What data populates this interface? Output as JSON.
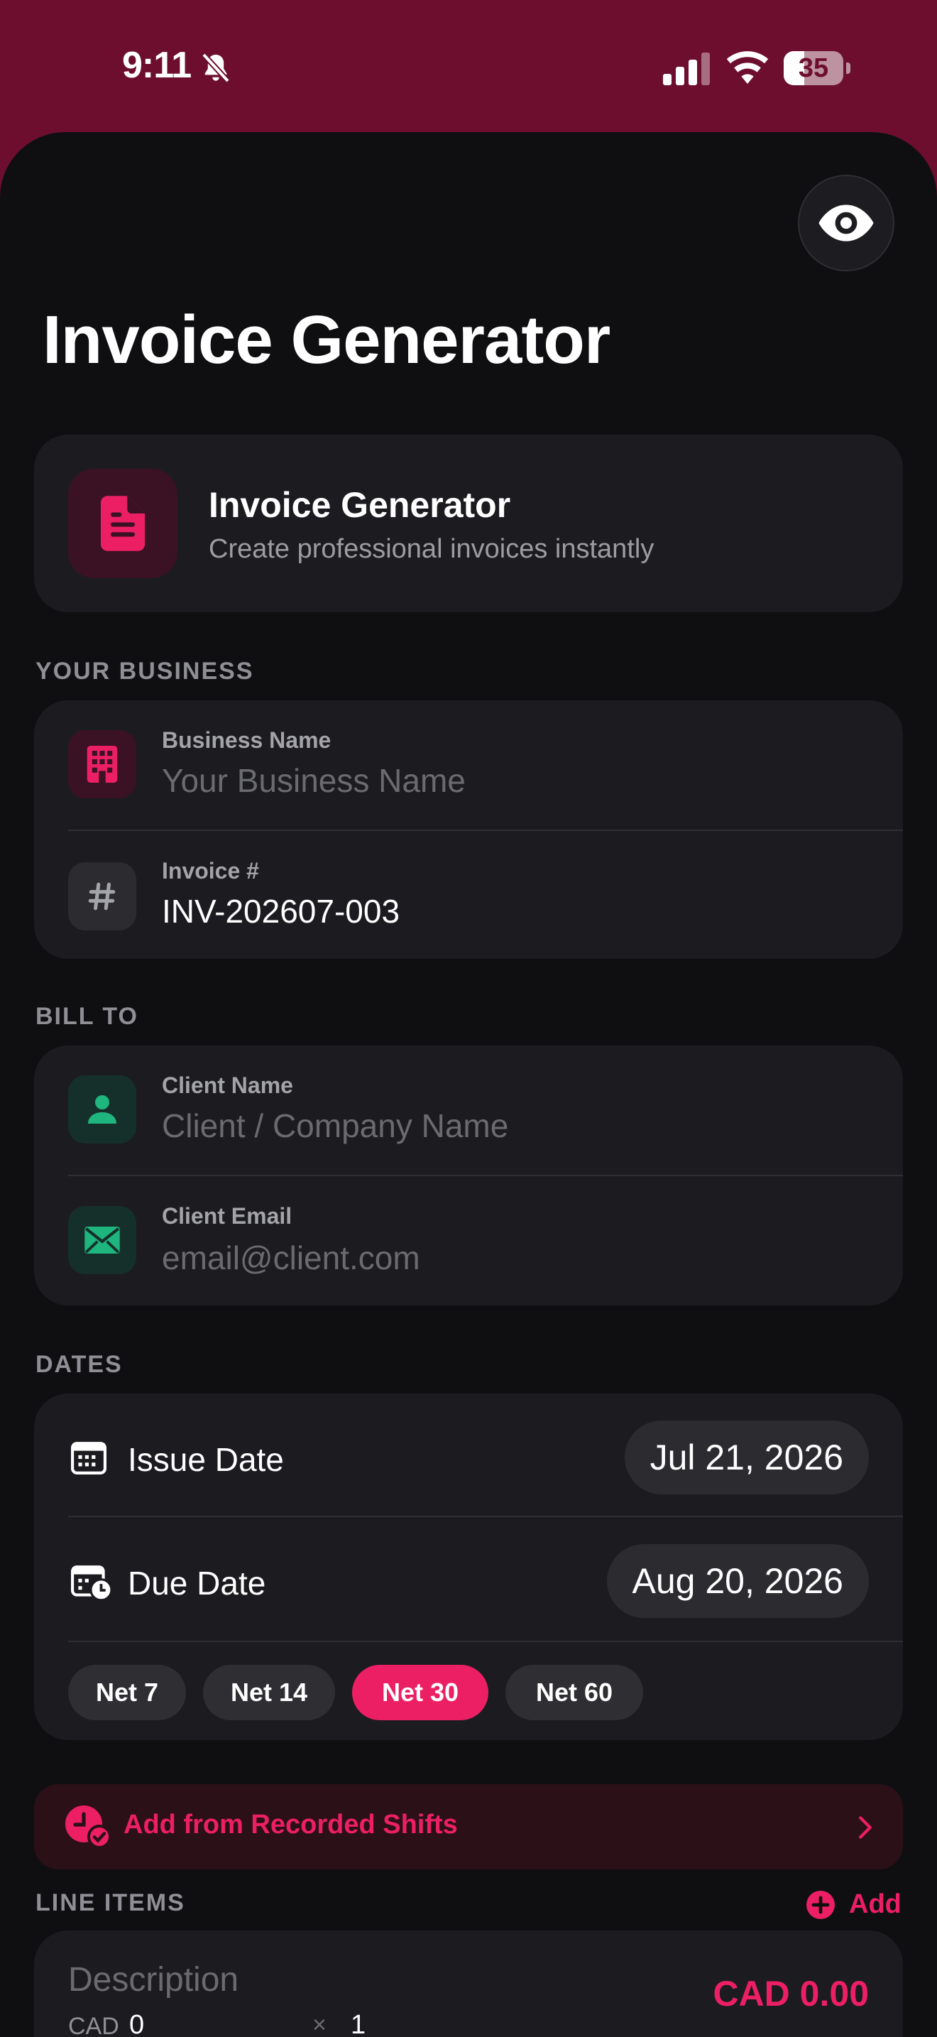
{
  "status_bar": {
    "time": "9:11",
    "battery": "35",
    "battery_level": 0.35
  },
  "page": {
    "title": "Invoice Generator"
  },
  "hero": {
    "title": "Invoice Generator",
    "subtitle": "Create professional invoices instantly",
    "icon": "document-icon"
  },
  "your_business": {
    "section_label": "YOUR BUSINESS",
    "business_name": {
      "label": "Business Name",
      "value": "",
      "placeholder": "Your Business Name",
      "icon": "building-icon"
    },
    "invoice_number": {
      "label": "Invoice #",
      "value": "INV-202607-003",
      "icon": "hash-icon"
    }
  },
  "bill_to": {
    "section_label": "BILL TO",
    "client_name": {
      "label": "Client Name",
      "value": "",
      "placeholder": "Client / Company Name",
      "icon": "person-icon"
    },
    "client_email": {
      "label": "Client Email",
      "value": "",
      "placeholder": "email@client.com",
      "icon": "envelope-icon"
    }
  },
  "dates": {
    "section_label": "DATES",
    "issue": {
      "label": "Issue Date",
      "value": "Jul 21, 2026"
    },
    "due": {
      "label": "Due Date",
      "value": "Aug 20, 2026"
    },
    "net_terms": [
      "Net 7",
      "Net 14",
      "Net 30",
      "Net 60"
    ],
    "selected_term": "Net 30"
  },
  "shifts": {
    "label": "Add from Recorded Shifts"
  },
  "line_items": {
    "section_label": "LINE ITEMS",
    "add_label": "Add",
    "items": [
      {
        "description_placeholder": "Description",
        "currency": "CAD",
        "rate": "0",
        "times": "×",
        "quantity": "1",
        "amount": "CAD 0.00"
      }
    ]
  },
  "colors": {
    "accent": "#ec1f64",
    "header_bg": "#6d0e2f",
    "background": "#0f0f11",
    "card": "#1c1c20",
    "client_icon": "#1fb57e"
  }
}
